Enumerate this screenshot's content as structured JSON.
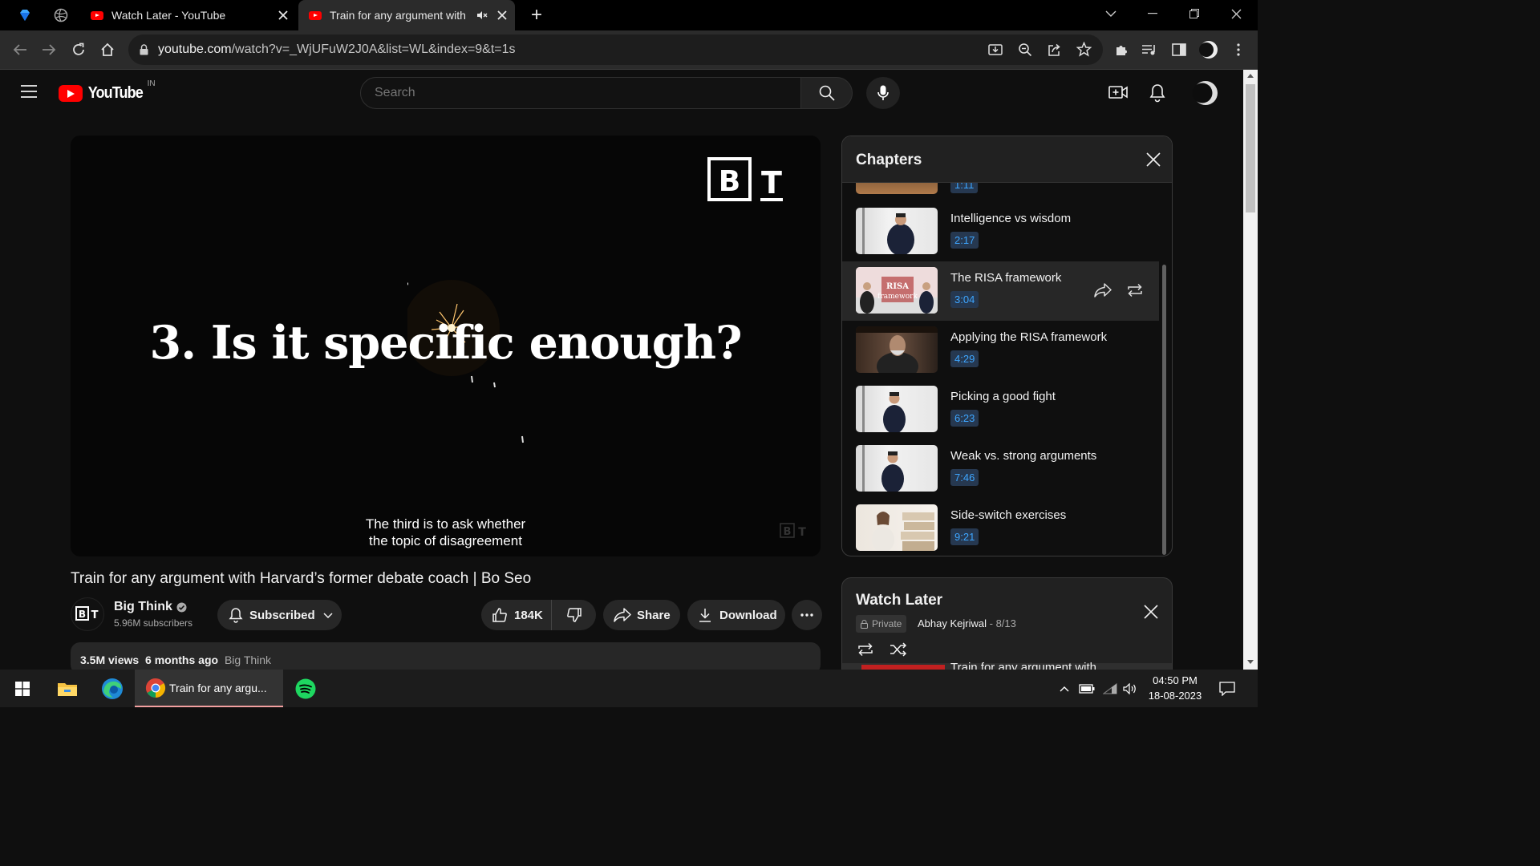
{
  "browser": {
    "tabs": [
      {
        "title": "Watch Later - YouTube",
        "active": false
      },
      {
        "title": "Train for any argument with I",
        "active": true,
        "muted": true
      }
    ],
    "new_tab_symbol": "+",
    "url_host": "youtube.com",
    "url_path": "/watch?v=_WjUFuW2J0A&list=WL&index=9&t=1s"
  },
  "youtube": {
    "logo_text": "YouTube",
    "region": "IN",
    "search_placeholder": "Search"
  },
  "player": {
    "brand_mark": "BT",
    "heading": "3. Is it specific enough?",
    "caption_line1": "The third is to ask whether",
    "caption_line2": "the topic of disagreement"
  },
  "video": {
    "title": "Train for any argument with Harvard’s former debate coach | Bo Seo",
    "channel": "Big Think",
    "subscribers": "5.96M subscribers",
    "subscribe_label": "Subscribed",
    "likes": "184K",
    "share_label": "Share",
    "download_label": "Download",
    "views": "3.5M views",
    "age": "6 months ago",
    "tag": "Big Think"
  },
  "chapters": {
    "title": "Chapters",
    "partial_time": "1:11",
    "items": [
      {
        "title": "Intelligence vs wisdom",
        "time": "2:17"
      },
      {
        "title": "The RISA framework",
        "time": "3:04",
        "active": true,
        "thumb_text": "RISA framework"
      },
      {
        "title": "Applying the RISA framework",
        "time": "4:29"
      },
      {
        "title": "Picking a good fight",
        "time": "6:23"
      },
      {
        "title": "Weak vs. strong arguments",
        "time": "7:46"
      },
      {
        "title": "Side-switch exercises",
        "time": "9:21"
      }
    ]
  },
  "watch_later": {
    "title": "Watch Later",
    "privacy": "Private",
    "owner": "Abhay Kejriwal",
    "position": "8/13",
    "partial_item": "Train for any argument with"
  },
  "taskbar": {
    "chrome_label": "Train for any argu...",
    "time": "04:50 PM",
    "date": "18-08-2023"
  },
  "colors": {
    "accent_red": "#ff0000",
    "link_blue": "#3ea6ff",
    "bg": "#0f0f0f"
  }
}
